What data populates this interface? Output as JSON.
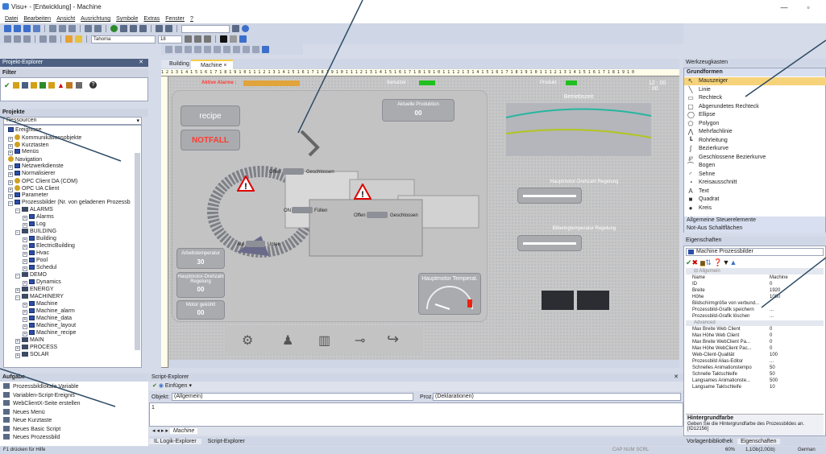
{
  "window": {
    "title": "Visu+ - [Entwicklung] - Machine",
    "minimize": "—",
    "restore": "▫"
  },
  "menu": [
    "Datei",
    "Bearbeiten",
    "Ansicht",
    "Ausrichtung",
    "Symbole",
    "Extras",
    "Fenster",
    "?"
  ],
  "toolbar": {
    "font": "Tahoma",
    "size": "18"
  },
  "project_explorer": {
    "title": "Projekt-Explorer",
    "filter": "Filter",
    "projects": "Projekte",
    "resources_label": "Ressourcen",
    "tree": [
      {
        "l": "Ereignisse",
        "d": 1,
        "t": "s"
      },
      {
        "l": "Kommunikationsobjekte",
        "d": 1,
        "t": "o",
        "x": "+"
      },
      {
        "l": "Kurztasten",
        "d": 1,
        "t": "o",
        "x": "+"
      },
      {
        "l": "Menüs",
        "d": 1,
        "t": "s",
        "x": "+"
      },
      {
        "l": "Navigation",
        "d": 1,
        "t": "o"
      },
      {
        "l": "Netzwerkdienste",
        "d": 1,
        "t": "s",
        "x": "+"
      },
      {
        "l": "Normalisierer",
        "d": 1,
        "t": "s",
        "x": "+"
      },
      {
        "l": "OPC Client DA (COM)",
        "d": 1,
        "t": "o",
        "x": "+"
      },
      {
        "l": "OPC UA Client",
        "d": 1,
        "t": "o",
        "x": "+"
      },
      {
        "l": "Parameter",
        "d": 1,
        "t": "s",
        "x": "+"
      },
      {
        "l": "Prozessbilder (Nr. von geladenen Prozessb",
        "d": 1,
        "t": "s",
        "x": "−"
      },
      {
        "l": "ALARMS",
        "d": 2,
        "t": "f",
        "x": "−"
      },
      {
        "l": "Alarms",
        "d": 3,
        "t": "s",
        "x": "+"
      },
      {
        "l": "Log",
        "d": 3,
        "t": "s",
        "x": "+"
      },
      {
        "l": "BUILDING",
        "d": 2,
        "t": "f",
        "x": "−"
      },
      {
        "l": "Building",
        "d": 3,
        "t": "s",
        "x": "+"
      },
      {
        "l": "ElectricBuilding",
        "d": 3,
        "t": "s",
        "x": "+"
      },
      {
        "l": "Hvac",
        "d": 3,
        "t": "s",
        "x": "+"
      },
      {
        "l": "Pool",
        "d": 3,
        "t": "s",
        "x": "+"
      },
      {
        "l": "Schedul",
        "d": 3,
        "t": "s",
        "x": "+"
      },
      {
        "l": "DEMO",
        "d": 2,
        "t": "f",
        "x": "−"
      },
      {
        "l": "Dynamics",
        "d": 3,
        "t": "s",
        "x": "+"
      },
      {
        "l": "ENERGY",
        "d": 2,
        "t": "f",
        "x": "+"
      },
      {
        "l": "MACHINERY",
        "d": 2,
        "t": "f",
        "x": "−"
      },
      {
        "l": "Machine",
        "d": 3,
        "t": "s",
        "x": "+"
      },
      {
        "l": "Machine_alarm",
        "d": 3,
        "t": "s",
        "x": "+"
      },
      {
        "l": "Machine_data",
        "d": 3,
        "t": "s",
        "x": "+"
      },
      {
        "l": "Machine_layout",
        "d": 3,
        "t": "s",
        "x": "+"
      },
      {
        "l": "Machine_recipe",
        "d": 3,
        "t": "s",
        "x": "+"
      },
      {
        "l": "MAIN",
        "d": 2,
        "t": "f",
        "x": "+"
      },
      {
        "l": "PROCESS",
        "d": 2,
        "t": "f",
        "x": "+"
      },
      {
        "l": "SOLAR",
        "d": 2,
        "t": "f",
        "x": "+"
      }
    ]
  },
  "tasks": {
    "title": "Aufgabe",
    "items": [
      "Prozessbildlokale Variable",
      "Variablen-Script-Ereignis",
      "WebClientX-Seite erstellen",
      "Neues Menü",
      "Neue Kurztaste",
      "Neues Basic Script",
      "Neues Prozessbild"
    ]
  },
  "tabs": {
    "building": "Building",
    "machine": "Machine",
    "close": "×"
  },
  "ruler": "1 2 1 3 1 4 1 5 1 6 1 7 1 8 1 9 1 0 1 1 1 2 1 3 1 4 1 5 1 6 1 7 1 8 1 9 1 0 1 1 1 2 1 3 1 4 1 5 1 6 1 7 1 8 1 9 1 0 1 1 1 2 1 3 1 4 1 5 1 6 1 7 1 8 1 9 1 0 1 1 1 2 1 3 1 4 1 5 1 6 1 7 1 8 1 9 1 0",
  "screen": {
    "active_alarms": "Aktive Alarme :",
    "user": "Benutzer :",
    "product": "Produkt :",
    "time": "12 : 00 : 00",
    "recipe": "recipe",
    "emergency": "NOTFALL",
    "current_production": "Aktuelle Produktion",
    "current_production_value": "00",
    "runtime": "Betriebszeit",
    "open": "Offen",
    "closed": "Geschlossen",
    "on": "ON",
    "off": "Füllen",
    "up": "Auf",
    "down": "Unten",
    "work_temp": "Arbeitstemperatur",
    "work_temp_value": "30",
    "motor_speed": "Hauptmotor-Drehzahl Regelung",
    "motor_speed_value": "00",
    "motor_cooled": "Motor gekühlt",
    "motor_cooled_value": "00",
    "motor_temp_gauge": "Hauptmotor Temperat.",
    "speed_reg": "Hauptmotor-Drehzahl Regelung",
    "temp_reg": "Bitteringtemperatur Regelung"
  },
  "script_explorer": {
    "title": "Script-Explorer",
    "insert": "Einfügen",
    "object_label": "Objekt:",
    "object_value": "(Allgemein)",
    "proc_label": "Proz.:",
    "proc_value": "(Deklarationen)",
    "line": "1",
    "tab": "Machine"
  },
  "bottom_tabs": {
    "logic": "IL Logik-Explorer",
    "script": "Script-Explorer"
  },
  "toolbox": {
    "title": "Werkzeugkasten",
    "group": "Grundformen",
    "items": [
      {
        "l": "Mauszeiger",
        "g": "↖"
      },
      {
        "l": "Linie",
        "g": "╲"
      },
      {
        "l": "Rechteck",
        "g": "▭"
      },
      {
        "l": "Abgerundetes Rechteck",
        "g": "▢"
      },
      {
        "l": "Ellipse",
        "g": "◯"
      },
      {
        "l": "Polygon",
        "g": "⬠"
      },
      {
        "l": "Mehrfachlinie",
        "g": "⋀"
      },
      {
        "l": "Rohrleitung",
        "g": "┗"
      },
      {
        "l": "Bezierkurve",
        "g": "∫"
      },
      {
        "l": "Geschlossene Bezierkurve",
        "g": "℘"
      },
      {
        "l": "Bogen",
        "g": "⌒"
      },
      {
        "l": "Sehne",
        "g": "◜"
      },
      {
        "l": "Kreisausschnitt",
        "g": "◔"
      },
      {
        "l": "Text",
        "g": "A"
      },
      {
        "l": "Quadrat",
        "g": "■"
      },
      {
        "l": "Kreis",
        "g": "●"
      }
    ],
    "group2": "Allgemeine Steuerelemente",
    "group3": "Not-Aus Schaltflächen"
  },
  "properties": {
    "title": "Eigenschaften",
    "object": "Machine Prozessbilder",
    "section": "Allgemein",
    "advanced": "Advanced",
    "rows": [
      [
        "Name",
        "Machine"
      ],
      [
        "ID",
        "0"
      ],
      [
        "Breite",
        "1920"
      ],
      [
        "Höhe",
        "1080"
      ],
      [
        "Bildschirmgröße von verbund...",
        ""
      ],
      [
        "Prozessbild-Grafik speichern",
        "..."
      ],
      [
        "Prozessbild-Grafik löschen",
        "..."
      ]
    ],
    "adv_rows": [
      [
        "Max Breite Web Client",
        "0"
      ],
      [
        "Max Höhe Web Client",
        "0"
      ],
      [
        "Max Breite WebClient Pa...",
        "0"
      ],
      [
        "Max Höhe WebClient Pac...",
        "0"
      ],
      [
        "Web-Client-Qualität",
        "100"
      ],
      [
        "Prozessbild Alias-Editor",
        "..."
      ],
      [
        "Schnelles Animationstempo",
        "50"
      ],
      [
        "Schnelle Taktschleife",
        "50"
      ],
      [
        "Langsames Animationste...",
        "500"
      ],
      [
        "Langsame Taktschleife",
        "10"
      ]
    ],
    "desc_title": "Hintergrundfarbe",
    "desc": "Geben Sie die Hintergrundfarbe des Prozessbildes an. [ID12156]"
  },
  "right_bottom_tabs": {
    "lib": "Vorlagenbibliothek",
    "props": "Eigenschaften"
  },
  "status": {
    "help": "F1 drücken für Hilfe",
    "caps": "CAP NUM SCRL",
    "zoom": "60%",
    "mem": "1,1Gb(2,0Gb)",
    "lang": "German"
  }
}
